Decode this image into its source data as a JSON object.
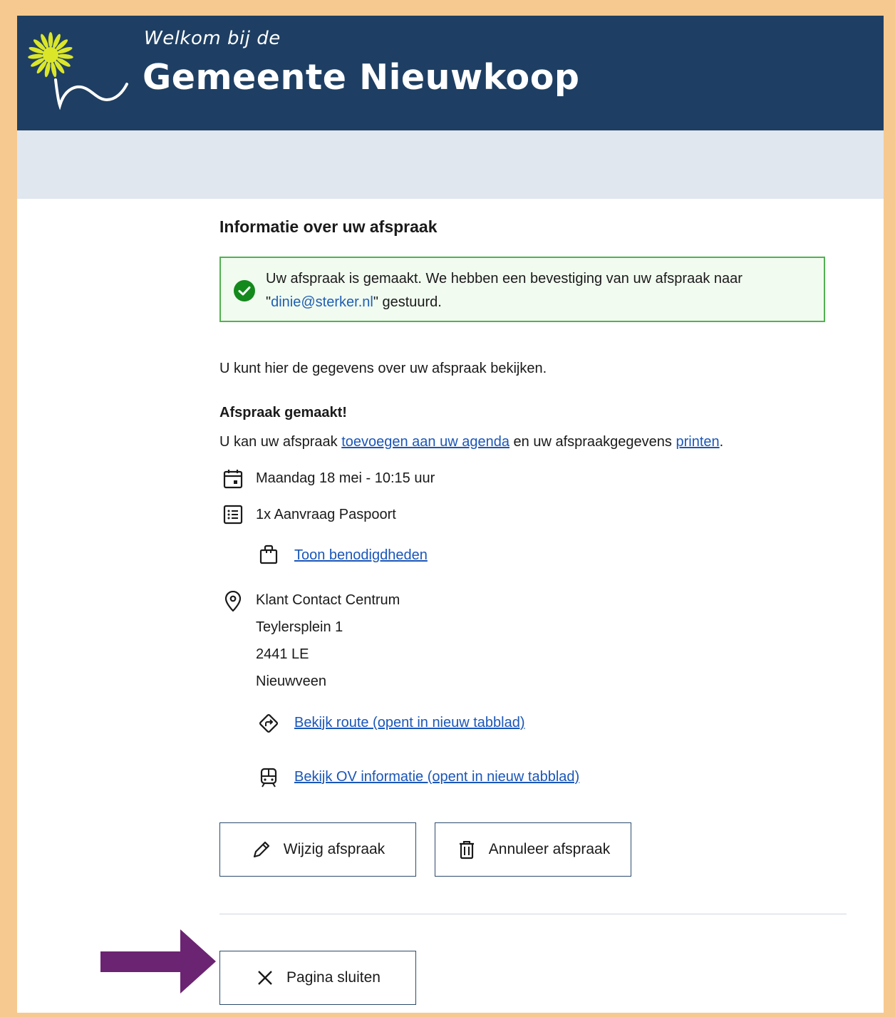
{
  "header": {
    "welcome": "Welkom bij de",
    "municipality": "Gemeente Nieuwkoop"
  },
  "page": {
    "title": "Informatie over uw afspraak"
  },
  "alert": {
    "text_before": "Uw afspraak is gemaakt. We hebben een bevestiging van uw afspraak naar",
    "quote_open": "\"",
    "email": "dinie@sterker.nl",
    "text_after": "\" gestuurd."
  },
  "intro": "U kunt hier de gegevens over uw afspraak bekijken.",
  "confirmation": {
    "heading": "Afspraak gemaakt!",
    "line_prefix": "U kan uw afspraak ",
    "agenda_link": "toevoegen aan uw agenda",
    "line_middle": " en uw afspraakgegevens ",
    "print_link": "printen",
    "line_suffix": "."
  },
  "appointment": {
    "date": "Maandag 18 mei - 10:15 uur",
    "product": "1x Aanvraag Paspoort",
    "requirements_link": "Toon benodigdheden",
    "location_name": "Klant Contact Centrum",
    "street": "Teylersplein 1",
    "postcode": "2441 LE",
    "city": "Nieuwveen",
    "route_link": "Bekijk route (opent in nieuw tabblad)",
    "ov_link": "Bekijk OV informatie (opent in nieuw tabblad)"
  },
  "actions": {
    "edit_label": "Wijzig afspraak",
    "cancel_label": "Annuleer afspraak",
    "close_label": "Pagina sluiten"
  },
  "icons": {
    "success": "check-circle-icon",
    "date": "calendar-icon",
    "product": "list-icon",
    "requirements": "shopping-bag-icon",
    "location": "map-pin-icon",
    "route": "directions-icon",
    "ov": "train-icon",
    "edit": "pencil-icon",
    "cancel": "trash-icon",
    "close": "close-icon"
  },
  "colors": {
    "page_border": "#f6c990",
    "header_bg": "#1e3f63",
    "subbar_bg": "#e1e7ee",
    "success_border": "#52b152",
    "success_bg": "#f1fbf0",
    "link": "#1a56b8",
    "annotation_arrow": "#6b2472",
    "logo_flower": "#dbe629"
  }
}
